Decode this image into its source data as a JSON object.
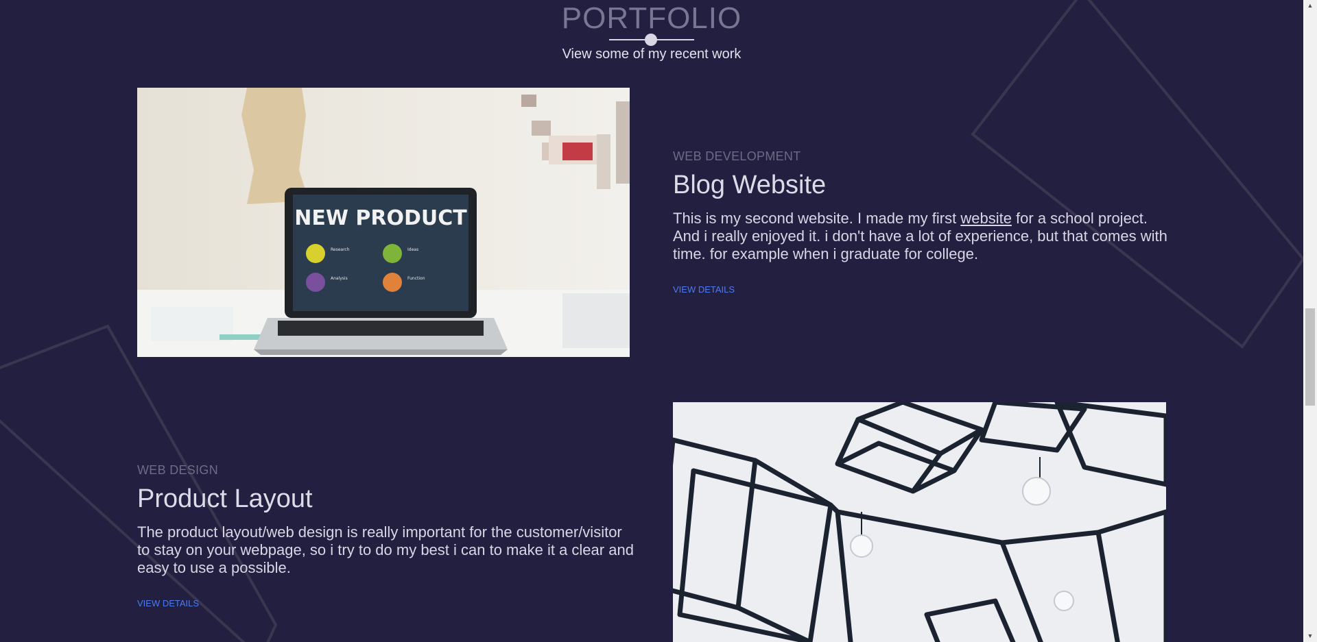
{
  "header": {
    "title": "PORTFOLIO",
    "subtitle": "View some of my recent work"
  },
  "projects": [
    {
      "category": "WEB DEVELOPMENT",
      "title": "Blog Website",
      "description_before": "This is my second website. I made my first ",
      "description_link": "website",
      "description_after": " for a school project. And i really enjoyed it. i don't have a lot of experience, but that comes with time. for example when i graduate for college.",
      "details_label": "VIEW DETAILS",
      "image": {
        "screen_title": "NEW PRODUCT",
        "items": [
          "Research",
          "Ideas",
          "Analysis",
          "Function"
        ]
      }
    },
    {
      "category": "WEB DESIGN",
      "title": "Product Layout",
      "description": "The product layout/web design is really important for the customer/visitor to stay on your webpage, so i try to do my best i can to make it a clear and easy to use a possible.",
      "details_label": "VIEW DETAILS"
    }
  ],
  "scrollbar": {
    "up_arrow": "▲",
    "down_arrow": "▼"
  },
  "colors": {
    "background": "#231f40",
    "link": "#4d7cf0",
    "muted": "#6f6a85"
  }
}
